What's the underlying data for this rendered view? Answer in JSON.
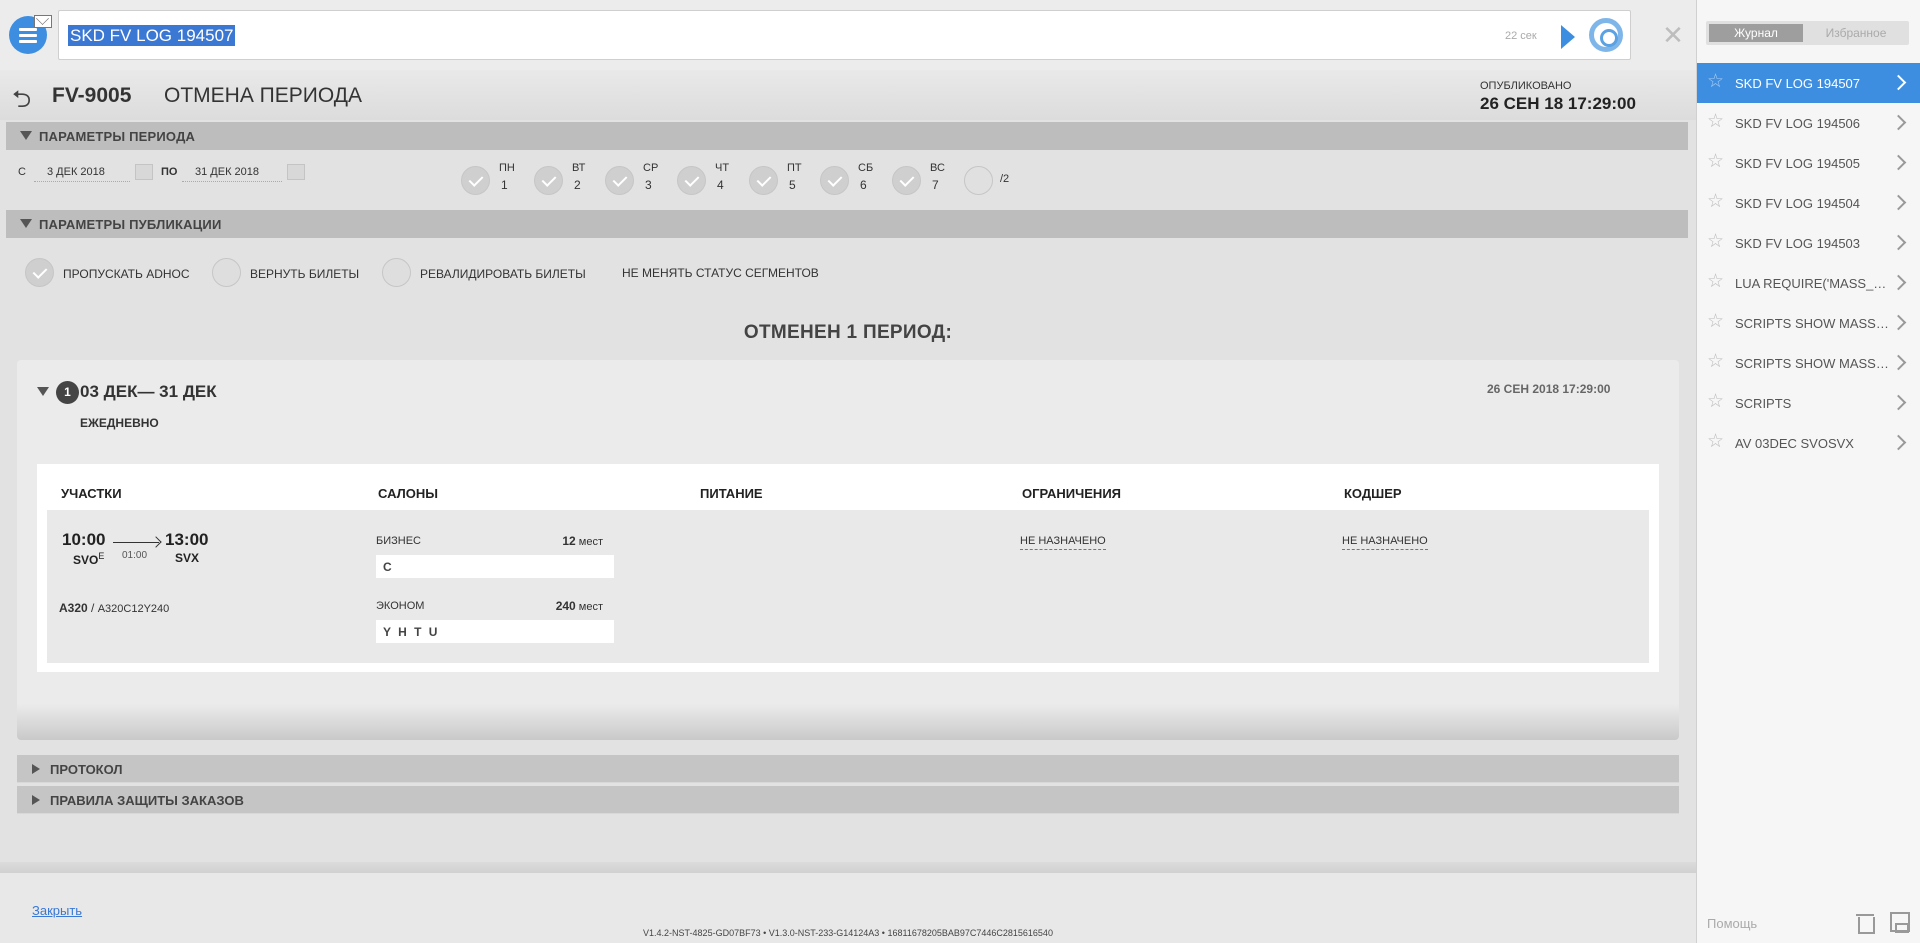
{
  "command": {
    "text": "SKD FV LOG 194507",
    "timer": "22 сек"
  },
  "header": {
    "flight": "FV-9005",
    "title": "ОТМЕНА ПЕРИОДА",
    "published_label": "ОПУБЛИКОВАНО",
    "published_date": "26 СЕН 18 17:29:00"
  },
  "period_params": {
    "section_label": "ПАРАМЕТРЫ ПЕРИОДА",
    "from_label": "С",
    "from_value": "3 ДЕК 2018",
    "to_label": "ПО",
    "to_value": "31 ДЕК 2018",
    "days": [
      {
        "name": "ПН",
        "num": "1"
      },
      {
        "name": "ВТ",
        "num": "2"
      },
      {
        "name": "СР",
        "num": "3"
      },
      {
        "name": "ЧТ",
        "num": "4"
      },
      {
        "name": "ПТ",
        "num": "5"
      },
      {
        "name": "СБ",
        "num": "6"
      },
      {
        "name": "ВС",
        "num": "7"
      }
    ],
    "frequency": "/2"
  },
  "pub_params": {
    "section_label": "ПАРАМЕТРЫ ПУБЛИКАЦИИ",
    "options": [
      {
        "label": "ПРОПУСКАТЬ ADHOC",
        "checked": true
      },
      {
        "label": "ВЕРНУТЬ БИЛЕТЫ",
        "checked": false
      },
      {
        "label": "РЕВАЛИДИРОВАТЬ БИЛЕТЫ",
        "checked": false
      }
    ],
    "status_note": "НЕ МЕНЯТЬ СТАТУС СЕГМЕНТОВ"
  },
  "result_heading": "ОТМЕНЕН 1 ПЕРИОД:",
  "period": {
    "number": "1",
    "range": "03 ДЕК— 31 ДЕК",
    "date": "26 СЕН 2018 17:29:00",
    "frequency": "ЕЖЕДНЕВНО",
    "columns": [
      "УЧАСТКИ",
      "САЛОНЫ",
      "ПИТАНИЕ",
      "ОГРАНИЧЕНИЯ",
      "КОДШЕР"
    ],
    "segment": {
      "dep_time": "10:00",
      "dep_airport": "SVO",
      "dep_terminal": "E",
      "duration": "01:00",
      "arr_time": "13:00",
      "arr_airport": "SVX",
      "aircraft_type": "A320",
      "aircraft_config": "A320C12Y240"
    },
    "classes": [
      {
        "name": "БИЗНЕС",
        "seats": "12",
        "seats_unit": "мест",
        "codes": "C"
      },
      {
        "name": "ЭКОНОМ",
        "seats": "240",
        "seats_unit": "мест",
        "codes": "Y H T U"
      }
    ],
    "restrictions": "НЕ НАЗНАЧЕНО",
    "codeshare": "НЕ НАЗНАЧЕНО"
  },
  "collapsed_sections": [
    "ПРОТОКОЛ",
    "ПРАВИЛА ЗАЩИТЫ ЗАКАЗОВ"
  ],
  "footer": {
    "close_label": "Закрыть",
    "version": "V1.4.2-NST-4825-GD07BF73  •  V1.3.0-NST-233-G14124A3  •  16811678205BAB97C7446C2815616540"
  },
  "sidebar": {
    "tabs": [
      "Журнал",
      "Избранное"
    ],
    "history": [
      "SKD FV LOG 194507",
      "SKD FV LOG 194506",
      "SKD FV LOG 194505",
      "SKD FV LOG 194504",
      "SKD FV LOG 194503",
      "LUA REQUIRE('MASS_FLIGHT')",
      "SCRIPTS SHOW MASS_FLIGHT",
      "SCRIPTS SHOW MASS_FLIGHT",
      "SCRIPTS",
      "AV 03DEC SVOSVX"
    ],
    "help_label": "Помощь"
  },
  "colors": {
    "accent": "#3d8ee0",
    "selection": "#3a78d4"
  }
}
